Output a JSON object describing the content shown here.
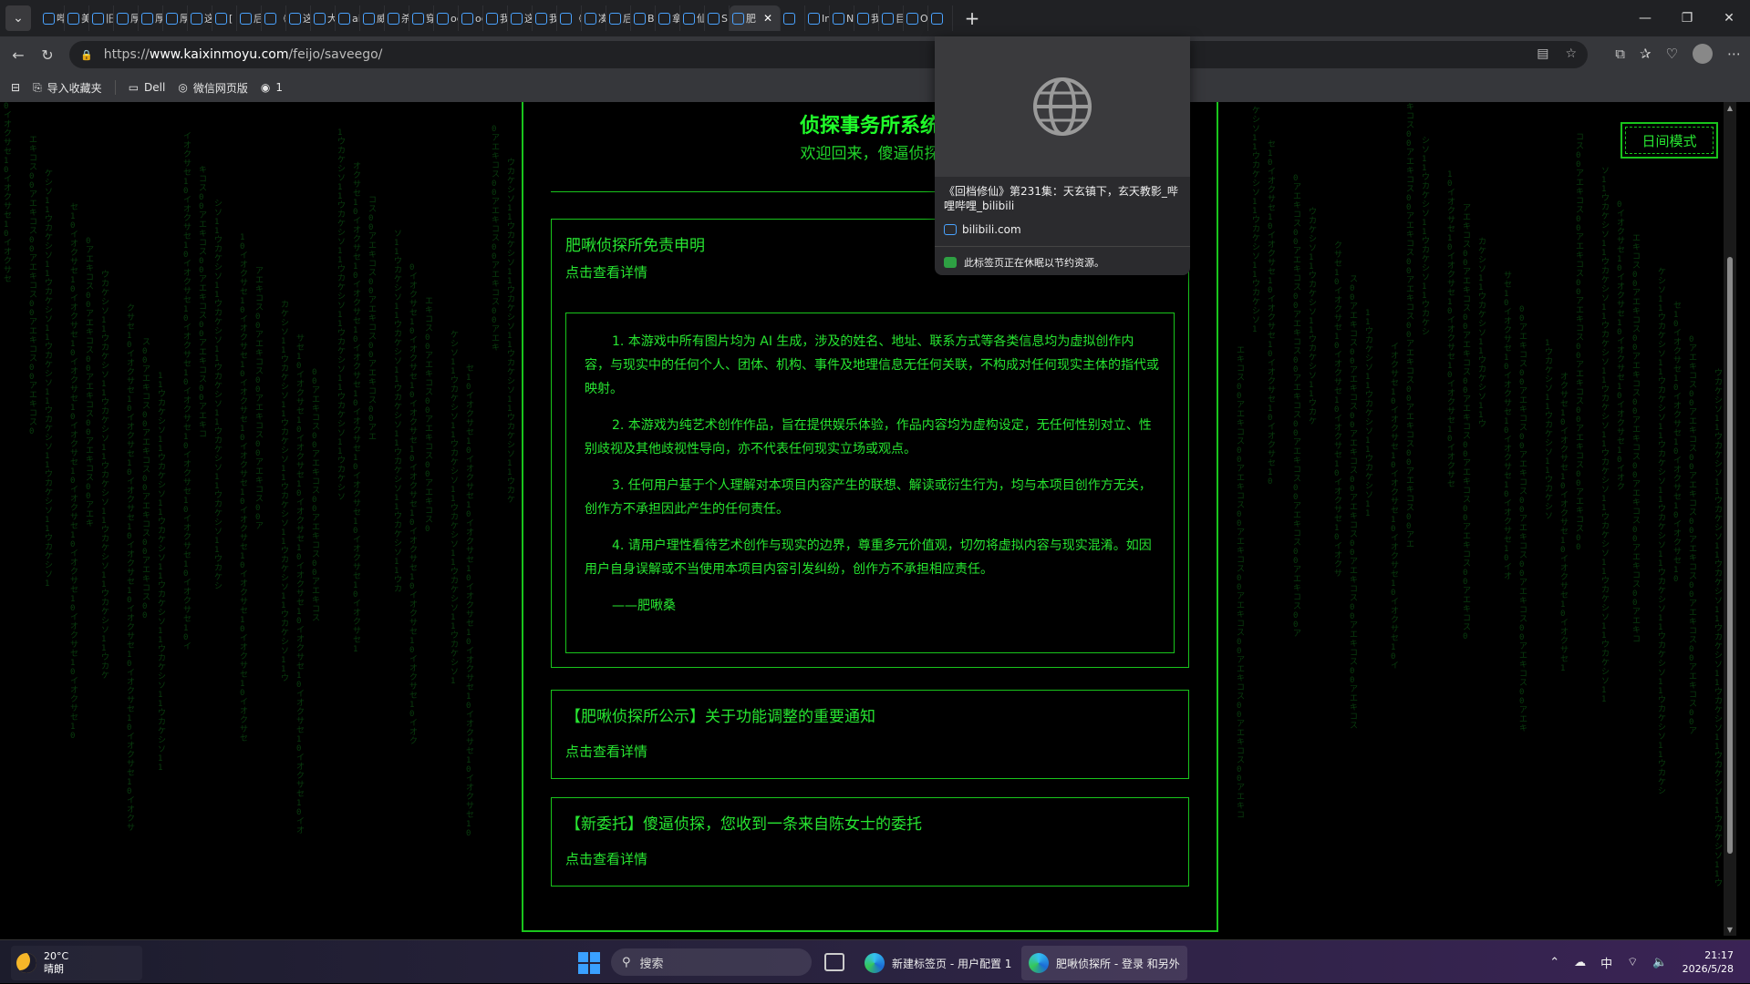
{
  "browser": {
    "tabs": [
      {
        "label": "哔"
      },
      {
        "label": "美"
      },
      {
        "label": "旧"
      },
      {
        "label": "厚"
      },
      {
        "label": "厚"
      },
      {
        "label": "厚"
      },
      {
        "label": "这"
      },
      {
        "label": "["
      },
      {
        "label": "后"
      },
      {
        "label": "《"
      },
      {
        "label": "这"
      },
      {
        "label": "大"
      },
      {
        "label": "ai"
      },
      {
        "label": "威"
      },
      {
        "label": "杀"
      },
      {
        "label": "穿"
      },
      {
        "label": "oc"
      },
      {
        "label": "oc"
      },
      {
        "label": "我"
      },
      {
        "label": "这"
      },
      {
        "label": "我"
      },
      {
        "label": "《"
      },
      {
        "label": "凑"
      },
      {
        "label": "后"
      },
      {
        "label": "Be"
      },
      {
        "label": "拿"
      },
      {
        "label": "仙"
      },
      {
        "label": "Sp"
      }
    ],
    "active_tab": {
      "label": "肥",
      "close": "✕"
    },
    "tabs_after": [
      {
        "label": ""
      },
      {
        "label": "Im"
      },
      {
        "label": "Nc"
      },
      {
        "label": "我"
      },
      {
        "label": "目"
      },
      {
        "label": "Ol"
      },
      {
        "label": ""
      }
    ],
    "new_tab": "+",
    "window_controls": {
      "minimize": "—",
      "restore": "❐",
      "close": "✕"
    },
    "url_scheme": "https://",
    "url_host": "www.kaixinmoyu.com",
    "url_path": "/feijo/saveego/",
    "bookmarks": [
      {
        "label": "导入收藏夹",
        "icon": "import-icon"
      },
      {
        "label": "Dell",
        "icon": "folder-icon"
      },
      {
        "label": "微信网页版",
        "icon": "globe-icon"
      },
      {
        "label": "1",
        "icon": "profile-icon"
      }
    ]
  },
  "hover_card": {
    "title": "《回档修仙》第231集：天玄镇下，玄天教影_哔哩哔哩_bilibili",
    "domain": "bilibili.com",
    "sleep_notice": "此标签页正在休眠以节约资源。"
  },
  "page": {
    "site_title": "侦探事务所系统",
    "welcome": "欢迎回来，傻逼侦探",
    "day_mode_label": "日间模式",
    "cards": [
      {
        "title": "肥啾侦探所免责申明",
        "link": "点击查看详情",
        "paragraphs": [
          "1. 本游戏中所有图片均为 AI 生成，涉及的姓名、地址、联系方式等各类信息均为虚拟创作内容，与现实中的任何个人、团体、机构、事件及地理信息无任何关联，不构成对任何现实主体的指代或映射。",
          "2. 本游戏为纯艺术创作作品，旨在提供娱乐体验，作品内容均为虚构设定，无任何性别对立、性别歧视及其他歧视性导向，亦不代表任何现实立场或观点。",
          "3. 任何用户基于个人理解对本项目内容产生的联想、解读或衍生行为，均与本项目创作方无关，创作方不承担因此产生的任何责任。",
          "4. 请用户理性看待艺术创作与现实的边界，尊重多元价值观，切勿将虚拟内容与现实混淆。如因用户自身误解或不当使用本项目内容引发纠纷，创作方不承担相应责任。"
        ],
        "signature": "——肥啾桑"
      },
      {
        "title": "【肥啾侦探所公示】关于功能调整的重要通知",
        "link": "点击查看详情"
      },
      {
        "title": "【新委托】傻逼侦探，您收到一条来自陈女士的委托",
        "link": "点击查看详情"
      }
    ]
  },
  "taskbar": {
    "weather_temp": "20°C",
    "weather_desc": "晴朗",
    "search_placeholder": "搜索",
    "apps": [
      {
        "label": "新建标签页 - 用户配置 1"
      },
      {
        "label": "肥啾侦探所 - 登录 和另外"
      }
    ],
    "ime": "中",
    "time": "21:17",
    "date": "2026/5/28"
  },
  "colors": {
    "matrix_green": "#27e531",
    "border_green": "#19c51c",
    "title_green": "#21ff2b"
  }
}
